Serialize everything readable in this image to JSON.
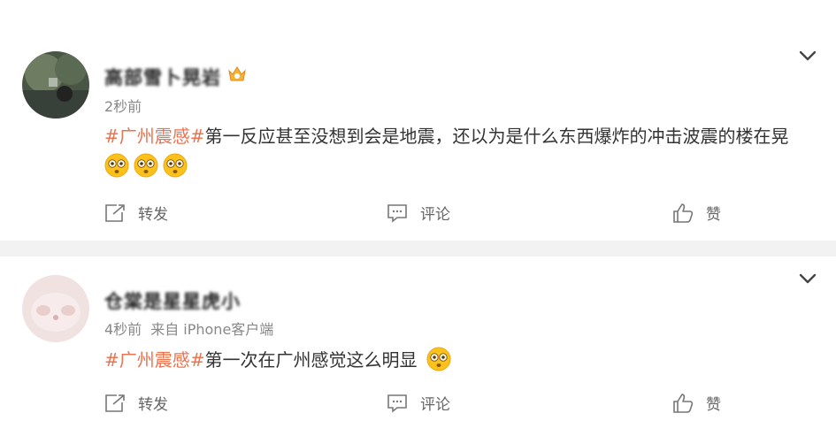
{
  "posts": [
    {
      "username": "高部雪卜晃岩",
      "time": "2秒前",
      "source": "",
      "topic": "#广州震感#",
      "text": "第一反应甚至没想到会是地震，还以为是什么东西爆炸的冲击波震的楼在晃",
      "emojis": [
        "flushed-emoji",
        "flushed-emoji",
        "flushed-emoji"
      ],
      "actions": {
        "share": "转发",
        "comment": "评论",
        "like": "赞"
      }
    },
    {
      "username": "仓棠是星星虎小",
      "time": "4秒前",
      "source": "来自 iPhone客户端",
      "topic": "#广州震感#",
      "text": "第一次在广州感觉这么明显",
      "emojis": [
        "flushed-emoji"
      ],
      "actions": {
        "share": "转发",
        "comment": "评论",
        "like": "赞"
      }
    }
  ],
  "colors": {
    "topic": "#eb7350",
    "muted": "#888888",
    "divider": "#f2f2f2"
  },
  "icons": [
    "chevron-down-icon",
    "share-icon",
    "comment-icon",
    "like-icon",
    "vip-crown-icon"
  ]
}
